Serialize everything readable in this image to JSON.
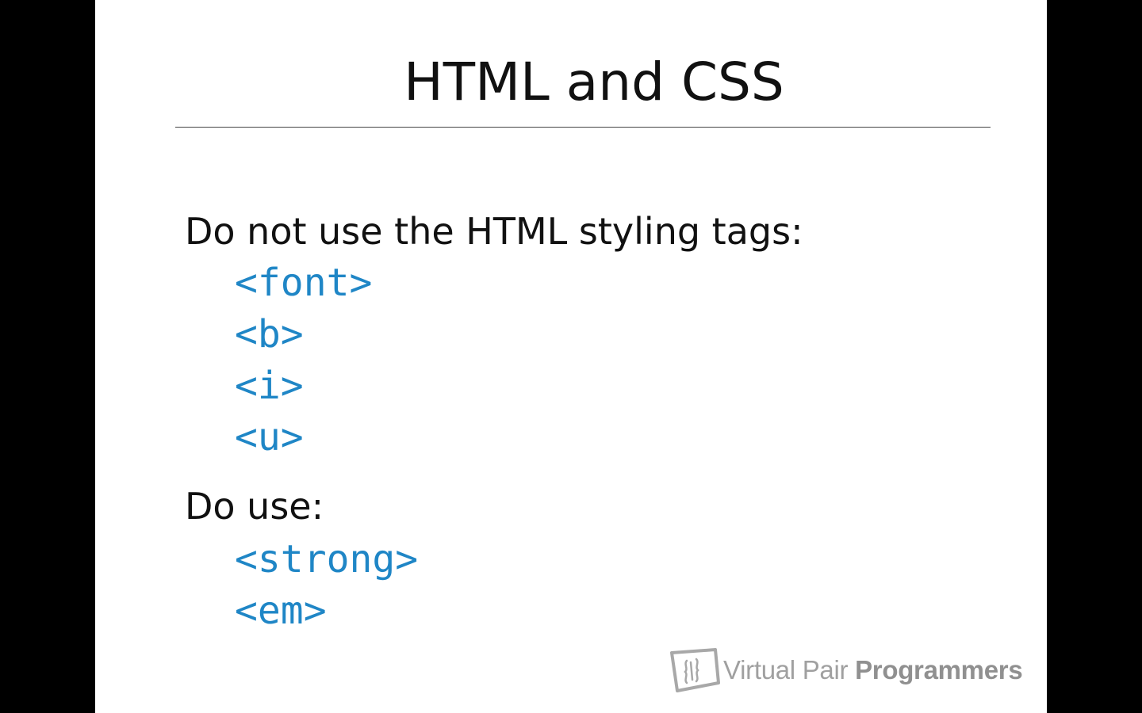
{
  "slide": {
    "title": "HTML and CSS",
    "avoid_heading": "Do not use the HTML styling tags:",
    "avoid_tags": [
      "<font>",
      "<b>",
      "<i>",
      "<u>"
    ],
    "use_heading": "Do use:",
    "use_tags": [
      "<strong>",
      "<em>"
    ]
  },
  "logo": {
    "name_light": "Virtual Pair ",
    "name_bold": "Programmers",
    "icon": "vpp-logo-icon"
  },
  "colors": {
    "background_letterbox": "#000000",
    "slide_background": "#ffffff",
    "text": "#111111",
    "code": "#1f86c6",
    "logo": "#a0a0a0"
  }
}
